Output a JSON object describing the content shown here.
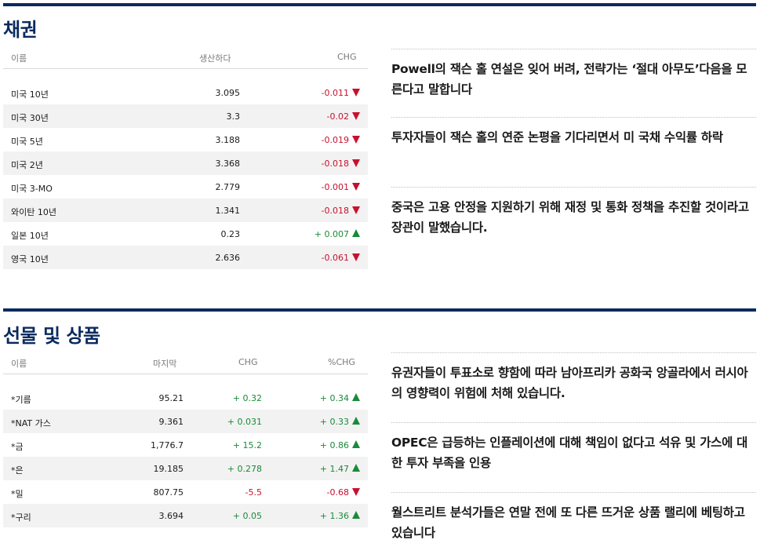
{
  "bonds": {
    "title": "채권",
    "headers": {
      "name": "이름",
      "yield": "생산하다",
      "chg": "CHG"
    },
    "rows": [
      {
        "name": "미국 10년",
        "yield": "3.095",
        "chg": "-0.011",
        "dir": "down"
      },
      {
        "name": "미국 30년",
        "yield": "3.3",
        "chg": "-0.02",
        "dir": "down"
      },
      {
        "name": "미국 5년",
        "yield": "3.188",
        "chg": "-0.019",
        "dir": "down"
      },
      {
        "name": "미국 2년",
        "yield": "3.368",
        "chg": "-0.018",
        "dir": "down"
      },
      {
        "name": "미국 3-MO",
        "yield": "2.779",
        "chg": "-0.001",
        "dir": "down"
      },
      {
        "name": "와이탄 10년",
        "yield": "1.341",
        "chg": "-0.018",
        "dir": "down"
      },
      {
        "name": "일본 10년",
        "yield": "0.23",
        "chg": "+ 0.007",
        "dir": "up"
      },
      {
        "name": "영국 10년",
        "yield": "2.636",
        "chg": "-0.061",
        "dir": "down"
      }
    ],
    "news": [
      "Powell의 잭슨 홀 연설은 잊어 버려, 전략가는 ‘절대 아무도’다음을 모른다고 말합니다",
      "투자자들이 잭슨 홀의 연준 논평을 기다리면서 미 국채 수익률 하락",
      "중국은 고용 안정을 지원하기 위해 재정 및 통화 정책을 추진할 것이라고 장관이 말했습니다."
    ]
  },
  "futures": {
    "title": "선물 및 상품",
    "headers": {
      "name": "이름",
      "last": "마지막",
      "chg": "CHG",
      "pct": "%CHG"
    },
    "rows": [
      {
        "name": "*기름",
        "last": "95.21",
        "chg": "+ 0.32",
        "pct": "+ 0.34",
        "dir": "up"
      },
      {
        "name": "*NAT 가스",
        "last": "9.361",
        "chg": "+ 0.031",
        "pct": "+ 0.33",
        "dir": "up"
      },
      {
        "name": "*금",
        "last": "1,776.7",
        "chg": "+ 15.2",
        "pct": "+ 0.86",
        "dir": "up"
      },
      {
        "name": "*은",
        "last": "19.185",
        "chg": "+ 0.278",
        "pct": "+ 1.47",
        "dir": "up"
      },
      {
        "name": "*밀",
        "last": "807.75",
        "chg": "-5.5",
        "pct": "-0.68",
        "dir": "down"
      },
      {
        "name": "*구리",
        "last": "3.694",
        "chg": "+ 0.05",
        "pct": "+ 1.36",
        "dir": "up"
      }
    ],
    "news": [
      "유권자들이 투표소로 향함에 따라 남아프리카 공화국 앙골라에서 러시아의 영향력이 위험에 처해 있습니다.",
      "OPEC은 급등하는 인플레이션에 대해 책임이 없다고 석유 및 가스에 대한 투자 부족을 인용",
      "월스트리트 분석가들은 연말 전에 또 다른 뜨거운 상품 랠리에 베팅하고 있습니다"
    ]
  },
  "colors": {
    "brand": "#0a2a5e",
    "negative": "#c8102e",
    "positive": "#1a8a3a"
  }
}
